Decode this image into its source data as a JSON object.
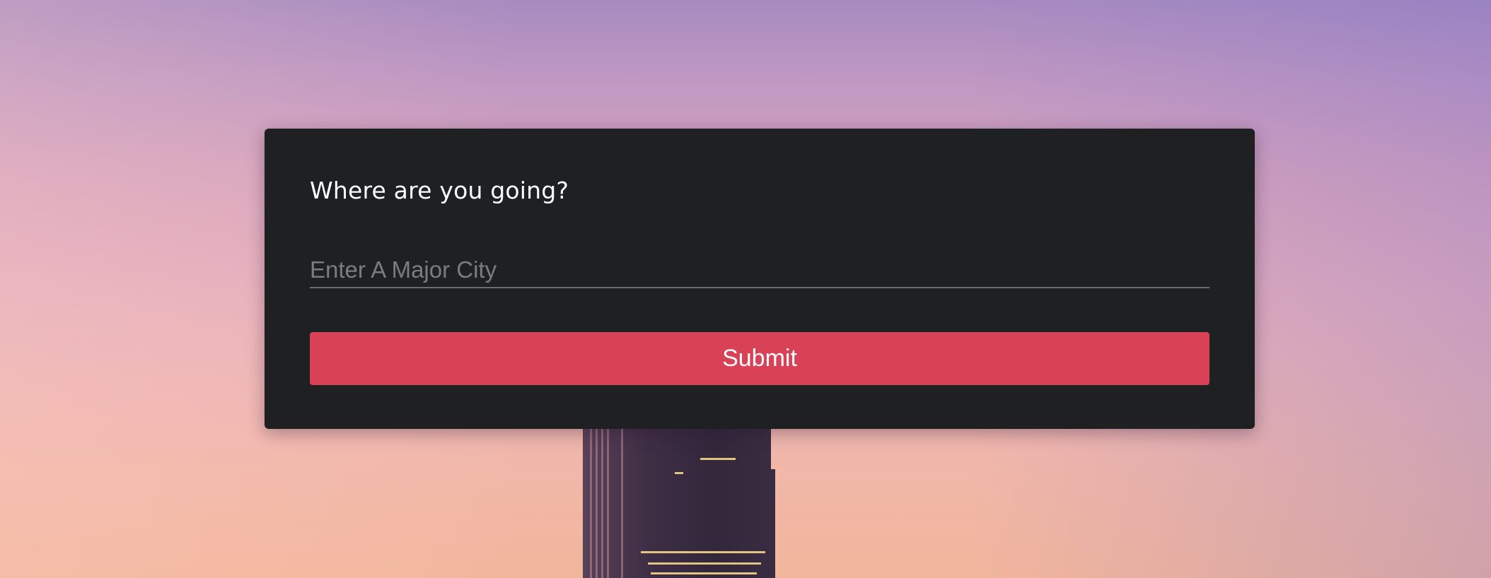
{
  "form": {
    "title": "Where are you going?",
    "city_input": {
      "value": "",
      "placeholder": "Enter A Major City"
    },
    "submit_label": "Submit"
  },
  "colors": {
    "card_background": "#1f2022",
    "button_accent": "#d94157",
    "title_text": "#ffffff",
    "placeholder_text": "#7b7c80"
  }
}
